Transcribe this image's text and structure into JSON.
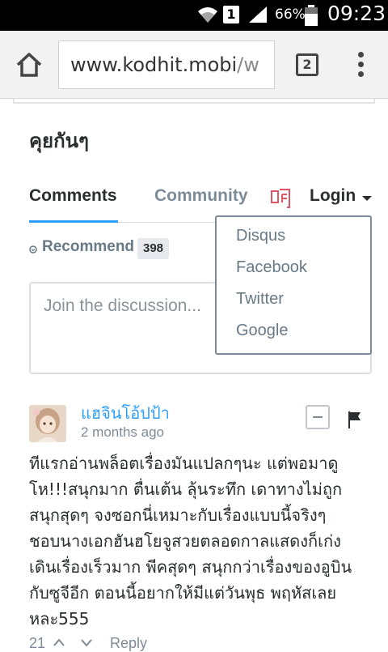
{
  "status_bar": {
    "battery_percent": "66%",
    "sim": "1",
    "time": "09:23"
  },
  "browser": {
    "url_main": "www.kodhit.mobi",
    "url_rest": "/w",
    "tab_count": "2"
  },
  "disqus": {
    "heading": "คุยกันๆ",
    "tabs": {
      "comments": "Comments",
      "community": "Community",
      "login": "Login"
    },
    "recommend": {
      "label": "Recommend",
      "count": "398"
    },
    "input_placeholder": "Join the discussion...",
    "login_menu": [
      "Disqus",
      "Facebook",
      "Twitter",
      "Google"
    ],
    "comment": {
      "author": "แฮจินโอ้ปป้า",
      "time": "2 months ago",
      "lines": [
        "ทีแรกอ่านพล็อตเรื่องมันแปลกๆนะ แต่พอมาดู",
        "โห!!!สนุกมาก ตื่นเต้น ลุ้นระทึก เดาทางไม่ถูก",
        "สนุกสุดๆ จงซอกนี่เหมาะกับเรื่องแบบนี้จริงๆ",
        "ชอบนางเอกฮันฮโยจูสวยตลอดกาลแสดงก็เก่ง",
        "เดินเรื่องเร็วมาก พีคสุดๆ สนุกกว่าเรื่องของอูบิน",
        "กับซูจีอีก ตอนนี้อยากให้มีแต่วันพุธ พฤหัสเลย",
        "หละ555"
      ],
      "votes": "21",
      "reply": "Reply"
    }
  },
  "colors": {
    "accent": "#2e9fff",
    "text": "#2a2e2e",
    "muted": "#7d8b98",
    "brand_icon": "#e05565"
  }
}
